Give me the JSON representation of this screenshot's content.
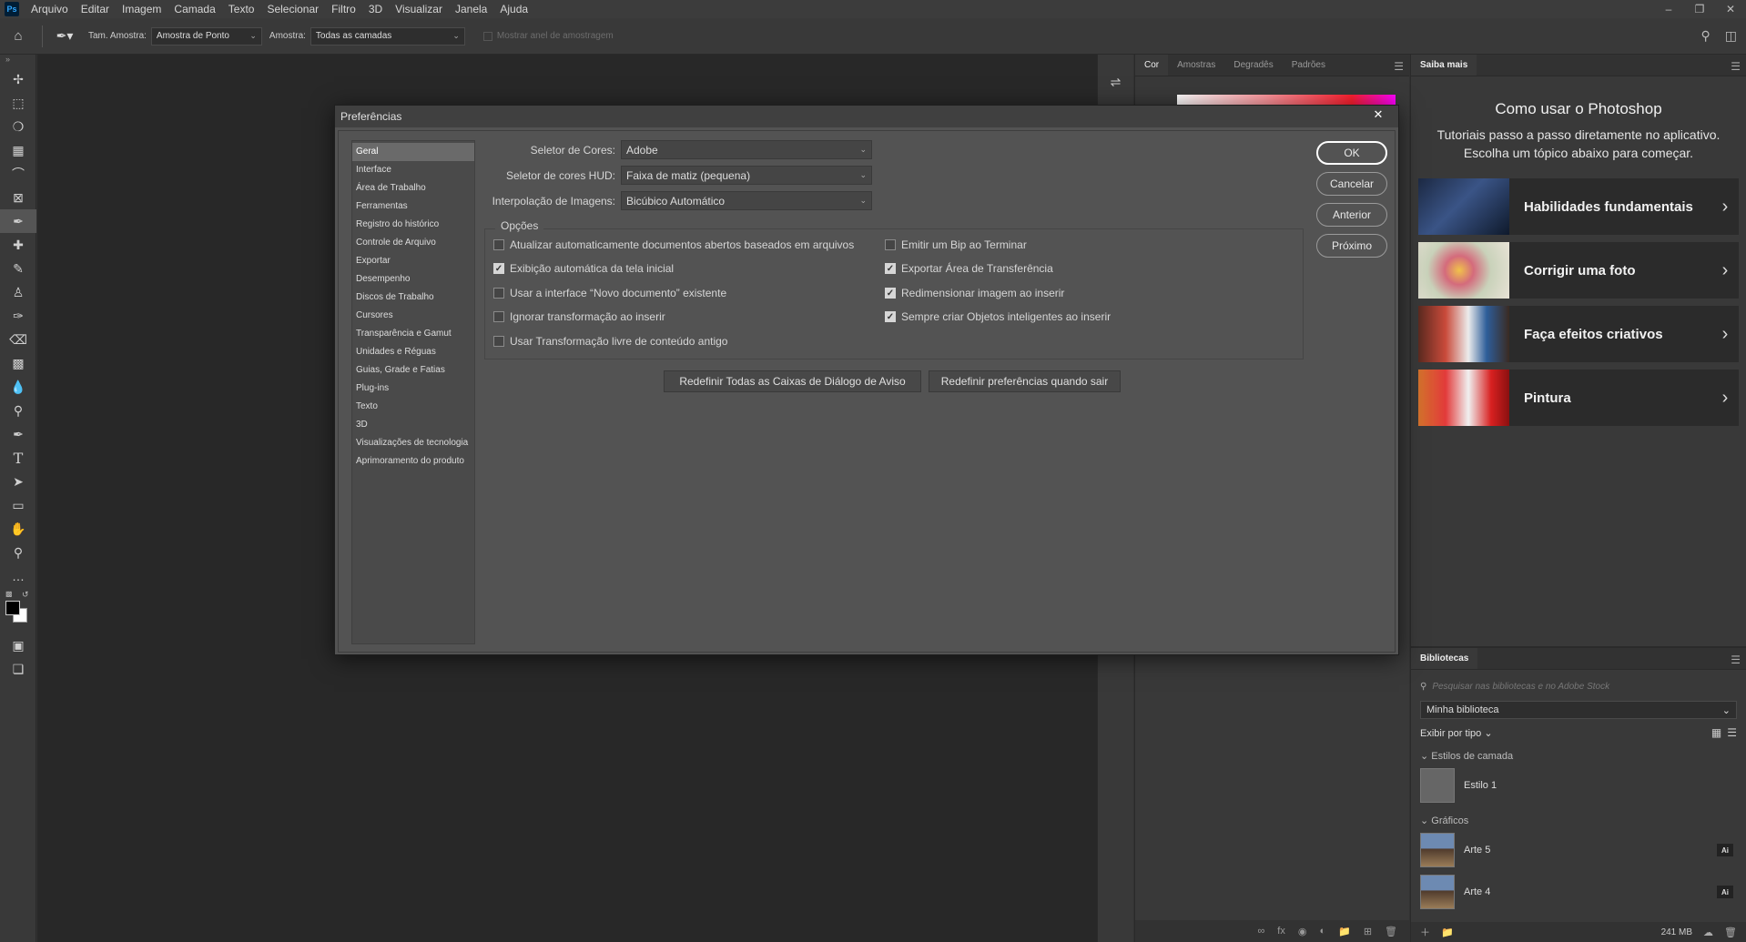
{
  "app": {
    "logo": "Ps",
    "menu": [
      "Arquivo",
      "Editar",
      "Imagem",
      "Camada",
      "Texto",
      "Selecionar",
      "Filtro",
      "3D",
      "Visualizar",
      "Janela",
      "Ajuda"
    ]
  },
  "options_bar": {
    "sample_size_label": "Tam. Amostra:",
    "sample_size_value": "Amostra de Ponto",
    "sample_label": "Amostra:",
    "sample_value": "Todas as camadas",
    "show_ring_label": "Mostrar anel de amostragem"
  },
  "color_panel": {
    "tabs": [
      "Cor",
      "Amostras",
      "Degradês",
      "Padrões"
    ],
    "active_tab": "Cor"
  },
  "learn_panel": {
    "tab": "Saiba mais",
    "title": "Como usar o Photoshop",
    "subtitle": "Tutoriais passo a passo diretamente no aplicativo. Escolha um tópico abaixo para começar.",
    "cards": [
      {
        "label": "Habilidades fundamentais",
        "icon": "chevron-right-icon"
      },
      {
        "label": "Corrigir uma foto",
        "icon": "chevron-right-icon"
      },
      {
        "label": "Faça efeitos criativos",
        "icon": "chevron-right-icon"
      },
      {
        "label": "Pintura",
        "icon": "chevron-right-icon"
      }
    ]
  },
  "libraries_panel": {
    "tab": "Bibliotecas",
    "search_placeholder": "Pesquisar nas bibliotecas e no Adobe Stock",
    "library": "Minha biblioteca",
    "view_by": "Exibir por tipo",
    "sections": [
      {
        "title": "Estilos de camada",
        "items": [
          {
            "name": "Estilo 1"
          }
        ]
      },
      {
        "title": "Gráficos",
        "items": [
          {
            "name": "Arte 5",
            "badge": "Ai"
          },
          {
            "name": "Arte 4",
            "badge": "Ai"
          }
        ]
      }
    ],
    "storage": "241 MB"
  },
  "dialog": {
    "title": "Preferências",
    "categories": [
      "Geral",
      "Interface",
      "Área de Trabalho",
      "Ferramentas",
      "Registro do histórico",
      "Controle de Arquivo",
      "Exportar",
      "Desempenho",
      "Discos de Trabalho",
      "Cursores",
      "Transparência e Gamut",
      "Unidades e Réguas",
      "Guias, Grade e Fatias",
      "Plug-ins",
      "Texto",
      "3D",
      "Visualizações de tecnologia",
      "Aprimoramento do produto"
    ],
    "active_category": "Geral",
    "fields": {
      "color_picker_label": "Seletor de Cores:",
      "color_picker_value": "Adobe",
      "hud_label": "Seletor de cores HUD:",
      "hud_value": "Faixa de matiz (pequena)",
      "interp_label": "Interpolação de Imagens:",
      "interp_value": "Bicúbico Automático"
    },
    "options_title": "Opções",
    "options_left": [
      {
        "label": "Atualizar automaticamente documentos abertos baseados em arquivos",
        "checked": false
      },
      {
        "label": "Exibição automática da tela inicial",
        "checked": true
      },
      {
        "label": "Usar a interface “Novo documento” existente",
        "checked": false
      },
      {
        "label": "Ignorar transformação ao inserir",
        "checked": false
      },
      {
        "label": "Usar Transformação livre de conteúdo antigo",
        "checked": false
      }
    ],
    "options_right": [
      {
        "label": "Emitir um Bip ao Terminar",
        "checked": false
      },
      {
        "label": "Exportar Área de Transferência",
        "checked": true
      },
      {
        "label": "Redimensionar imagem ao inserir",
        "checked": true
      },
      {
        "label": "Sempre criar Objetos inteligentes ao inserir",
        "checked": true
      }
    ],
    "reset_warnings": "Redefinir Todas as Caixas de Diálogo de Aviso",
    "reset_prefs": "Redefinir preferências quando sair",
    "buttons": {
      "ok": "OK",
      "cancel": "Cancelar",
      "prev": "Anterior",
      "next": "Próximo"
    }
  },
  "colors": {
    "accent": "#31a8ff",
    "panel_bg": "#393939",
    "dialog_bg": "#535353"
  }
}
